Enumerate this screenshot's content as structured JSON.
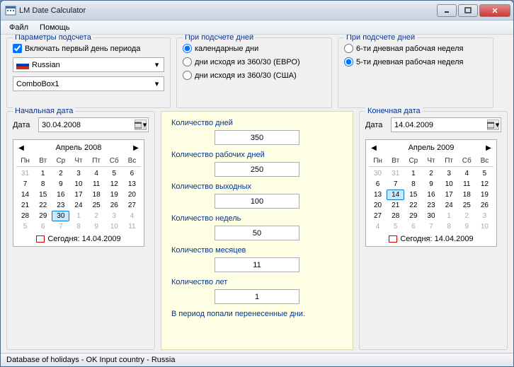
{
  "window": {
    "title": "LM Date Calculator"
  },
  "menu": {
    "file": "Файл",
    "help": "Помощь"
  },
  "params": {
    "legend": "Параметры подсчета",
    "include_first": "Включать первый день периода",
    "include_first_checked": true,
    "lang": "Russian",
    "combo": "ComboBox1"
  },
  "counting1": {
    "legend": "При подсчете дней",
    "opt1": "календарные дни",
    "opt2": "дни исходя из 360/30 (ЕВРО)",
    "opt3": "дни исходя из 360/30 (США)",
    "selected": 0
  },
  "counting2": {
    "legend": "При подсчете дней",
    "opt1": "6-ти дневная рабочая неделя",
    "opt2": "5-ти дневная рабочая неделя",
    "selected": 1
  },
  "start": {
    "legend": "Начальная дата",
    "date_label": "Дата",
    "date_value": "30.04.2008",
    "cal_title": "Апрель 2008",
    "today_label": "Сегодня: 14.04.2009"
  },
  "end": {
    "legend": "Конечная дата",
    "date_label": "Дата",
    "date_value": "14.04.2009",
    "cal_title": "Апрель 2009",
    "today_label": "Сегодня: 14.04.2009"
  },
  "dow": [
    "Пн",
    "Вт",
    "Ср",
    "Чт",
    "Пт",
    "Сб",
    "Вс"
  ],
  "cal_start": {
    "prev": [
      "31"
    ],
    "days": [
      "1",
      "2",
      "3",
      "4",
      "5",
      "6",
      "7",
      "8",
      "9",
      "10",
      "11",
      "12",
      "13",
      "14",
      "15",
      "16",
      "17",
      "18",
      "19",
      "20",
      "21",
      "22",
      "23",
      "24",
      "25",
      "26",
      "27",
      "28",
      "29",
      "30"
    ],
    "next": [
      "1",
      "2",
      "3",
      "4",
      "5",
      "6",
      "7",
      "8",
      "9",
      "10",
      "11"
    ],
    "selected": "30"
  },
  "cal_end": {
    "prev": [
      "30",
      "31"
    ],
    "days": [
      "1",
      "2",
      "3",
      "4",
      "5",
      "6",
      "7",
      "8",
      "9",
      "10",
      "11",
      "12",
      "13",
      "14",
      "15",
      "16",
      "17",
      "18",
      "19",
      "20",
      "21",
      "22",
      "23",
      "24",
      "25",
      "26",
      "27",
      "28",
      "29",
      "30"
    ],
    "next": [
      "1",
      "2",
      "3",
      "4",
      "5",
      "6",
      "7",
      "8",
      "9",
      "10"
    ],
    "selected": "14"
  },
  "mid": {
    "days_label": "Количество дней",
    "days": "350",
    "workdays_label": "Количество рабочих дней",
    "workdays": "250",
    "holidays_label": "Количество выходных",
    "holidays": "100",
    "weeks_label": "Количество недель",
    "weeks": "50",
    "months_label": "Количество месяцев",
    "months": "11",
    "years_label": "Количество лет",
    "years": "1",
    "note": "В период попали перенесенные дни."
  },
  "status": "Database of holidays - OK Input country - Russia"
}
